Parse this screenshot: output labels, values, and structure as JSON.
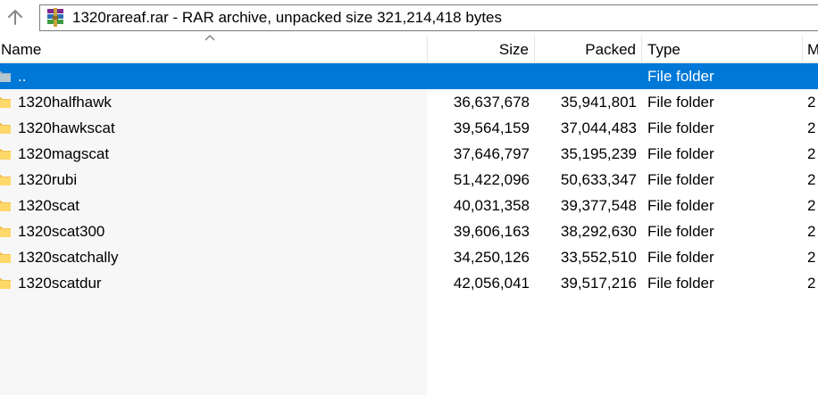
{
  "window": {
    "path_text": "1320rareaf.rar - RAR archive, unpacked size 321,214,418 bytes",
    "icons": {
      "up": "up-arrow-icon",
      "archive": "winrar-archive-icon",
      "folder": "folder-icon"
    }
  },
  "columns": {
    "name": "Name",
    "size": "Size",
    "packed": "Packed",
    "type": "Type",
    "modified": "M"
  },
  "colors": {
    "selection": "#0078d7",
    "folder": "#f0c24f"
  },
  "rows": [
    {
      "name": "..",
      "size": "",
      "packed": "",
      "type": "File folder",
      "modified": "",
      "selected": true
    },
    {
      "name": "1320halfhawk",
      "size": "36,637,678",
      "packed": "35,941,801",
      "type": "File folder",
      "modified": "2"
    },
    {
      "name": "1320hawkscat",
      "size": "39,564,159",
      "packed": "37,044,483",
      "type": "File folder",
      "modified": "2"
    },
    {
      "name": "1320magscat",
      "size": "37,646,797",
      "packed": "35,195,239",
      "type": "File folder",
      "modified": "2"
    },
    {
      "name": "1320rubi",
      "size": "51,422,096",
      "packed": "50,633,347",
      "type": "File folder",
      "modified": "2"
    },
    {
      "name": "1320scat",
      "size": "40,031,358",
      "packed": "39,377,548",
      "type": "File folder",
      "modified": "2"
    },
    {
      "name": "1320scat300",
      "size": "39,606,163",
      "packed": "38,292,630",
      "type": "File folder",
      "modified": "2"
    },
    {
      "name": "1320scatchally",
      "size": "34,250,126",
      "packed": "33,552,510",
      "type": "File folder",
      "modified": "2"
    },
    {
      "name": "1320scatdur",
      "size": "42,056,041",
      "packed": "39,517,216",
      "type": "File folder",
      "modified": "2"
    }
  ]
}
